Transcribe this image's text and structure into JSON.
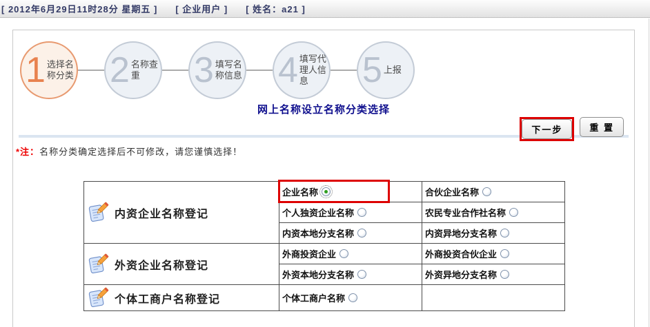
{
  "header": {
    "datetime": "[ 2012年6月29日11时28分 星期五 ]",
    "account_type": "[ 企业用户 ]",
    "username": "[ 姓名：a21 ]"
  },
  "wizard": {
    "title": "网上名称设立名称分类选择",
    "steps": [
      {
        "num": "1",
        "label": "选择名称分类"
      },
      {
        "num": "2",
        "label": "名称查重"
      },
      {
        "num": "3",
        "label": "填写名称信息"
      },
      {
        "num": "4",
        "label": "填写代理人信息"
      },
      {
        "num": "5",
        "label": "上报"
      }
    ],
    "active_step": "1"
  },
  "toolbar": {
    "next_label": "下一步",
    "reset_label": "重 置"
  },
  "note": {
    "prefix": "*注：",
    "text": "名称分类确定选择后不可修改，请您谨慎选择！"
  },
  "table": {
    "selected_option": "企业名称",
    "groups": [
      {
        "label": "内资企业名称登记",
        "rows": [
          [
            "企业名称",
            "合伙企业名称"
          ],
          [
            "个人独资企业名称",
            "农民专业合作社名称"
          ],
          [
            "内资本地分支名称",
            "内资异地分支名称"
          ]
        ]
      },
      {
        "label": "外资企业名称登记",
        "rows": [
          [
            "外商投资企业",
            "外商投资合伙企业"
          ],
          [
            "外资本地分支名称",
            "外资异地分支名称"
          ]
        ]
      },
      {
        "label": "个体工商户名称登记",
        "rows": [
          [
            "个体工商户名称",
            ""
          ]
        ]
      }
    ]
  },
  "colors": {
    "active_step_border": "#e89a70",
    "active_step_fill": "#fcf1e8",
    "inactive_step_border": "#c3cbd6",
    "highlight_red": "#dd0000",
    "title_blue": "#10108e",
    "header_navy": "#333a66",
    "divider_blue": "#dbe5f1",
    "radio_dot_green": "#2e9e1e"
  }
}
